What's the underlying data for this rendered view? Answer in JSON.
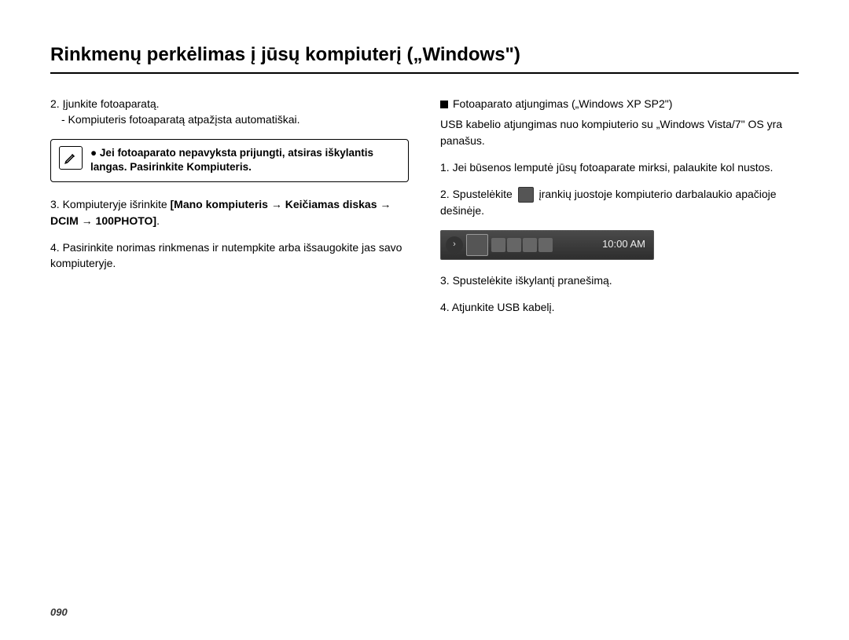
{
  "title": "Rinkmenų perkėlimas į jūsų kompiuterį („Windows\")",
  "page_number": "090",
  "left": {
    "step2": "2. Įjunkite fotoaparatą.",
    "step2_sub": "- Kompiuteris fotoaparatą atpažįsta automatiškai.",
    "note_bullet": "●",
    "note_text_a": "Jei fotoaparato nepavyksta prijungti, atsiras iškylantis langas. Pasirinkite ",
    "note_text_b": "Kompiuteris",
    "note_text_c": ".",
    "step3_a": "3. Kompiuteryje išrinkite ",
    "step3_b": "[Mano kompiuteris → Keičiamas diskas → DCIM → 100PHOTO]",
    "step3_c": ".",
    "step4": "4. Pasirinkite norimas rinkmenas ir nutempkite arba išsaugokite jas savo kompiuteryje."
  },
  "right": {
    "section_title": "Fotoaparato atjungimas („Windows XP SP2\")",
    "intro": "USB kabelio atjungimas nuo kompiuterio su „Windows Vista/7\" OS yra panašus.",
    "step1": "1. Jei būsenos lemputė jūsų fotoaparate mirksi, palaukite kol nustos.",
    "step2_a": "2. Spustelėkite ",
    "step2_b": " įrankių juostoje kompiuterio darbalaukio apačioje dešinėje.",
    "taskbar_time": "10:00 AM",
    "step3": "3. Spustelėkite iškylantį pranešimą.",
    "step4": "4. Atjunkite USB kabelį."
  }
}
